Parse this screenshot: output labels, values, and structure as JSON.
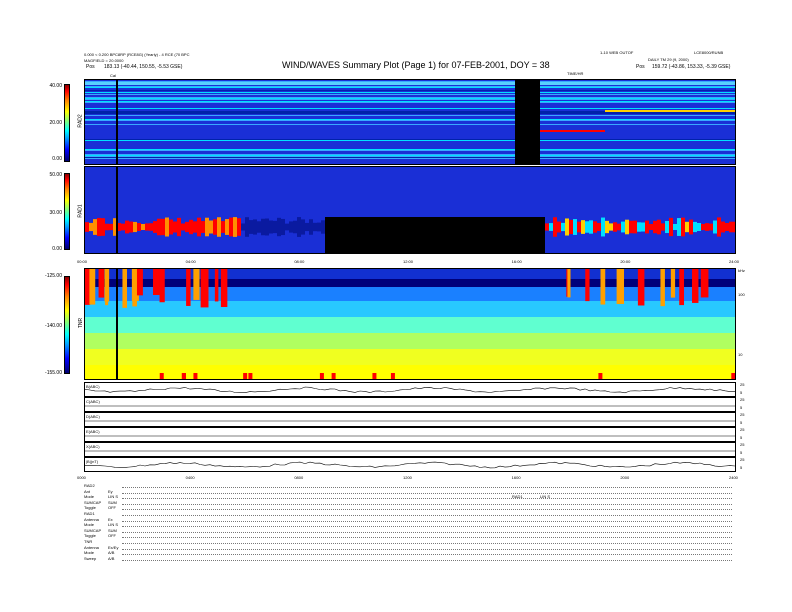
{
  "header": {
    "title": "WIND/WAVES Summary Plot (Page 1) for 07-FEB-2001, DOY = 38",
    "left_line1": "0.000 < 0.200 BPC8RP (RCE8G) (Yearly) - 4 RCE (70 BPC",
    "left_line2": "MAGFIELD = 20.0000",
    "left_pos_label": "Pos",
    "left_pos_value": "183.13 (-40.44, 150.55, -5.53 GSE)",
    "right_line1": "1-10 WEB OUTOF",
    "right_line2": "LCE8000/RUNB",
    "right_line3": "DAILY TM 29 (9, 2000)",
    "right_pos_label": "Pos",
    "right_pos_value": "159.72 (-43.86, 153.33, -5.39 GSE)",
    "tm_label": "TIME/HR",
    "cal_label": "Cal"
  },
  "panels": [
    {
      "name": "RAD2",
      "ticks": [
        "40.00",
        "20.00",
        "0.00"
      ]
    },
    {
      "name": "RAD1",
      "ticks": [
        "50.00",
        "30.00",
        "0.00"
      ]
    },
    {
      "name": "TNR",
      "ticks": [
        "-125.00",
        "-140.00",
        "-155.00"
      ],
      "right_ticks": [
        "100",
        "10"
      ],
      "right_label": "kHz"
    }
  ],
  "time_axis": {
    "labels": [
      "00:00",
      "04:00",
      "08:00",
      "12:00",
      "16:00",
      "20:00",
      "24:00"
    ]
  },
  "time_axis_bottom": {
    "labels": [
      "0000",
      "0400",
      "0800",
      "1200",
      "1600",
      "2000",
      "2400"
    ]
  },
  "lanes": [
    {
      "label": "B(ABC)",
      "right_top": "25",
      "right_bot": "5"
    },
    {
      "label": "C(ABC)",
      "right_top": "25",
      "right_bot": "5"
    },
    {
      "label": "D(ABC)",
      "right_top": "25",
      "right_bot": "5"
    },
    {
      "label": "E(ABC)",
      "right_top": "25",
      "right_bot": "5"
    },
    {
      "label": "X(ABC)",
      "right_top": "25",
      "right_bot": "5"
    },
    {
      "label": "|B|(nT)",
      "right_top": "25",
      "right_bot": "5"
    }
  ],
  "footer": {
    "rad2_title": "RAD2",
    "rad2_rows": [
      {
        "k": "Ant",
        "v": "Ey"
      },
      {
        "k": "Mode",
        "v": "LIN S"
      },
      {
        "k": "SUMCAP",
        "v": "SUM"
      },
      {
        "k": "Toggle",
        "v": "OFF"
      }
    ],
    "rad1_title": "RAD1",
    "rad1_rows": [
      {
        "k": "Antenna",
        "v": "Ex"
      },
      {
        "k": "Mode",
        "v": "LIN S"
      },
      {
        "k": "SUMCAP",
        "v": "SUM"
      },
      {
        "k": "Toggle",
        "v": "OFF"
      }
    ],
    "tnr_title": "TNR",
    "tnr_rows": [
      {
        "k": "Antenna",
        "v": "Ex/Ey"
      },
      {
        "k": "Mode",
        "v": "A/B"
      },
      {
        "k": "Sweep",
        "v": "A/B"
      }
    ],
    "mid_key": "RAD1",
    "mid_val": "LIN S"
  },
  "colors": {
    "bg_blue": "#1a2fd6",
    "deep": "#00007a",
    "cyan": "#00ffff",
    "yellow": "#ffff00",
    "red": "#ff0000",
    "black": "#000000"
  }
}
